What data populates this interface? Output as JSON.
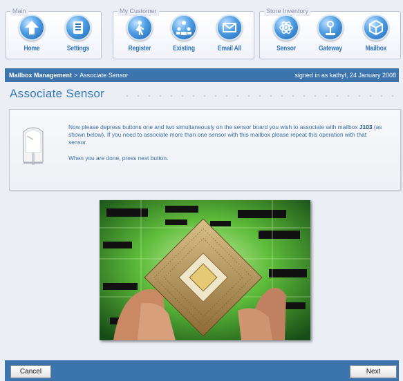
{
  "nav": {
    "groups": [
      {
        "title": "Main",
        "items": [
          {
            "label": "Home",
            "icon": "home-icon"
          },
          {
            "label": "Settings",
            "icon": "settings-icon"
          }
        ]
      },
      {
        "title": "My Customer",
        "items": [
          {
            "label": "Register",
            "icon": "register-icon"
          },
          {
            "label": "Existing",
            "icon": "existing-icon"
          },
          {
            "label": "Email All",
            "icon": "email-icon"
          }
        ]
      },
      {
        "title": "Store Inventory",
        "items": [
          {
            "label": "Sensor",
            "icon": "sensor-icon"
          },
          {
            "label": "Gateway",
            "icon": "gateway-icon"
          },
          {
            "label": "Mailbox",
            "icon": "mailbox-icon"
          }
        ]
      }
    ]
  },
  "breadcrumb": {
    "section": "Mailbox Management",
    "separator": ">",
    "current": "Associate Sensor",
    "signed_in": "signed in as kathyf, 24 January 2008"
  },
  "page": {
    "title": "Associate Sensor"
  },
  "instructions": {
    "line1_part1": "Now please depress buttons one and two simultaneously on the sensor board you wish to associate with mailbox ",
    "mailbox_id": "J103",
    "line1_part2": " (as shown below).  If you need to associate more than one sensor with this mailbox please repeat this operation with that sensor.",
    "line2": "When you are done, press next button."
  },
  "footer": {
    "cancel_label": "Cancel",
    "next_label": "Next"
  },
  "colors": {
    "accent": "#3c74ad",
    "title": "#2f78b7",
    "nav_label": "#2e74c0",
    "background": "#eceef6"
  }
}
